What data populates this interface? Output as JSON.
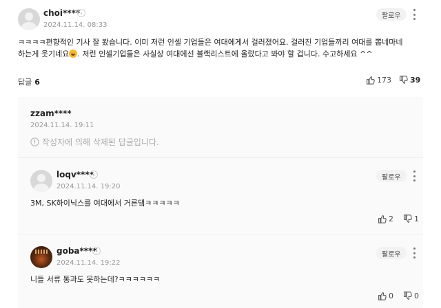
{
  "comment": {
    "nickname": "choi****",
    "date": "2024.11.14. 08:33",
    "follow_label": "팔로우",
    "text_before_emoji": "ㅋㅋㅋㅋ편향적인 기사 잘 봤습니다. 이미 저런 인셀 기업들은 여대에게서 걸러졌어요. 걸러진 기업들끼리 여대를 뽑네마네 하는게 웃기네요",
    "text_after_emoji": ". 저런 인셀기업들은 사실상 여대에선 블랙리스트에 올랐다고 봐야 할 겁니다. 수고하세요 ^^",
    "reply_label": "답글",
    "reply_count": "6",
    "likes": "173",
    "dislikes": "39"
  },
  "replies": [
    {
      "nickname": "zzam****",
      "date": "2024.11.14. 19:11",
      "deleted_notice": "작성자에 의해 삭제된 답글입니다."
    },
    {
      "nickname": "loqv****",
      "date": "2024.11.14. 19:20",
      "follow_label": "팔로우",
      "text": "3M, SK하이닉스를 여대에서 거른댘ㅋㅋㅋㅋㅋ",
      "likes": "2",
      "dislikes": "1",
      "avatar": "default-avatar"
    },
    {
      "nickname": "goba****",
      "date": "2024.11.14. 19:22",
      "follow_label": "팔로우",
      "text": "니들 서류 통과도 못하는데?ㅋㅋㅋㅋㅋㅋ",
      "likes": "0",
      "dislikes": "0",
      "avatar": "photo-avatar"
    }
  ],
  "colors": {
    "reply_background": "#fafafa",
    "muted_text": "#999999",
    "button_background": "#f2f2f2"
  }
}
